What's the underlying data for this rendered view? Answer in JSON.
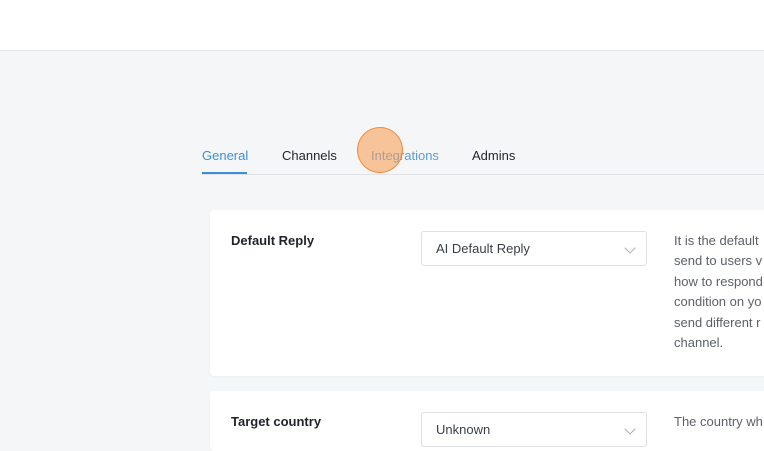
{
  "tabs": {
    "general": "General",
    "channels": "Channels",
    "integrations": "Integrations",
    "admins": "Admins"
  },
  "settings": {
    "default_reply": {
      "label": "Default Reply",
      "value": "AI Default Reply",
      "description": "It is the default\nsend to users v\nhow to respond\ncondition on yo\nsend different r\nchannel."
    },
    "target_country": {
      "label": "Target country",
      "value": "Unknown",
      "description": "The country wh"
    }
  },
  "colors": {
    "accent": "#3d8fd6",
    "click_indicator": "#f79a4e"
  }
}
